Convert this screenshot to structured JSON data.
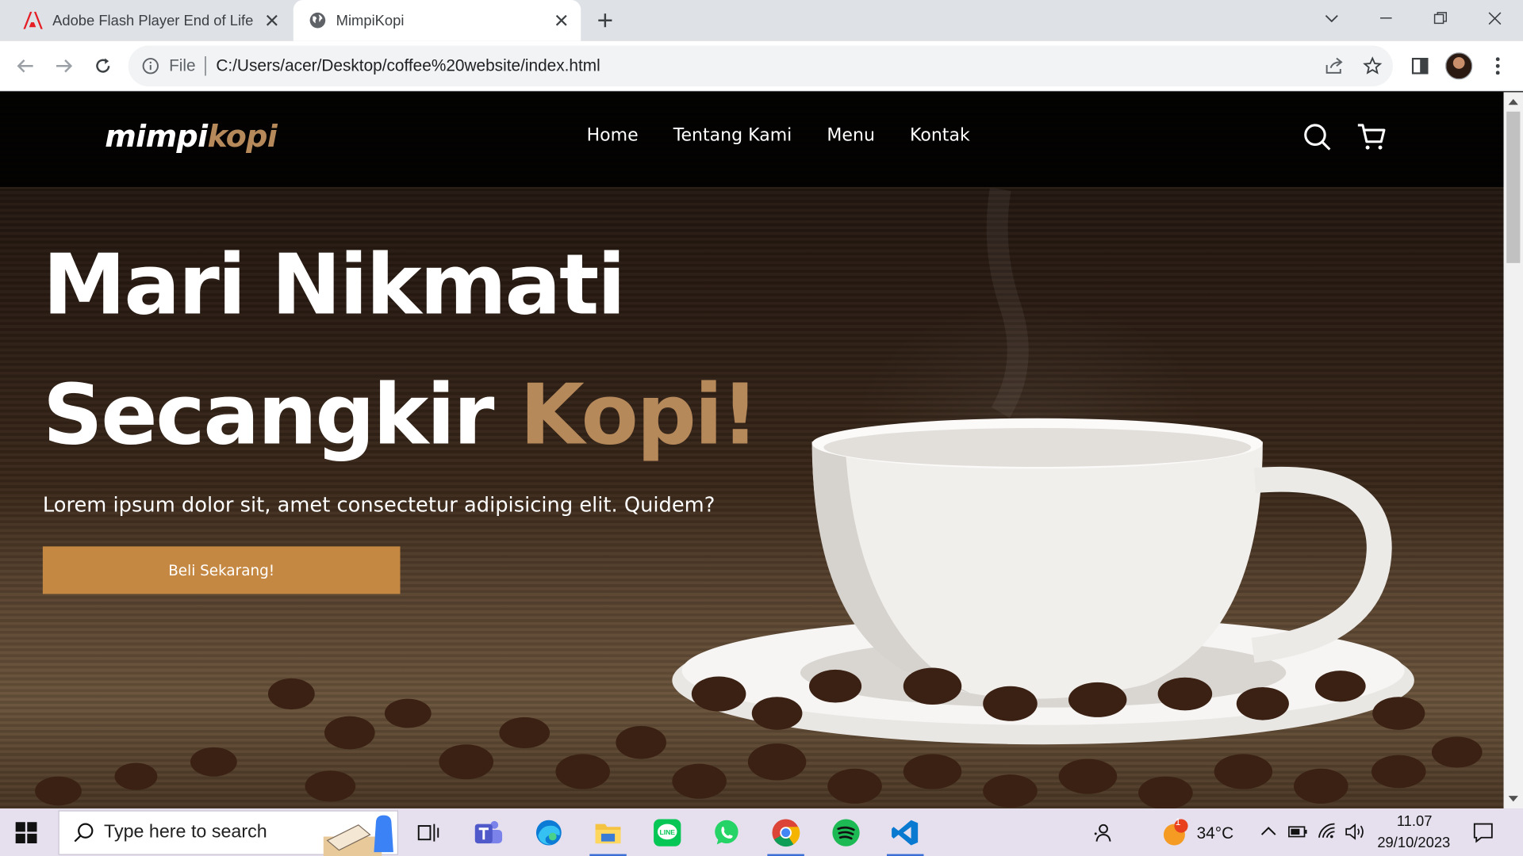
{
  "browser": {
    "tabs": [
      {
        "title": "Adobe Flash Player End of Life",
        "icon": "adobe-icon",
        "active": false
      },
      {
        "title": "MimpiKopi",
        "icon": "globe-icon",
        "active": true
      }
    ],
    "address": {
      "scheme": "File",
      "url": "C:/Users/acer/Desktop/coffee%20website/index.html"
    }
  },
  "site": {
    "logo": {
      "part1": "mimpi",
      "part2": "kopi"
    },
    "nav": [
      {
        "label": "Home"
      },
      {
        "label": "Tentang Kami"
      },
      {
        "label": "Menu"
      },
      {
        "label": "Kontak"
      }
    ],
    "hero": {
      "line1": "Mari Nikmati",
      "line2_main": "Secangkir",
      "line2_accent": "Kopi!",
      "subtitle": "Lorem ipsum dolor sit, amet consectetur adipisicing elit. Quidem?",
      "cta": "Beli Sekarang!"
    },
    "colors": {
      "accent": "#b6895b",
      "button": "#c58842",
      "navbar": "#010101"
    }
  },
  "taskbar": {
    "search_placeholder": "Type here to search",
    "apps": [
      "task-view-icon",
      "teams-icon",
      "edge-icon",
      "file-explorer-icon",
      "line-icon",
      "whatsapp-icon",
      "chrome-icon",
      "spotify-icon",
      "vscode-icon"
    ],
    "weather": {
      "temp": "34°C",
      "badge": "1"
    },
    "time": "11.07",
    "date": "29/10/2023"
  }
}
